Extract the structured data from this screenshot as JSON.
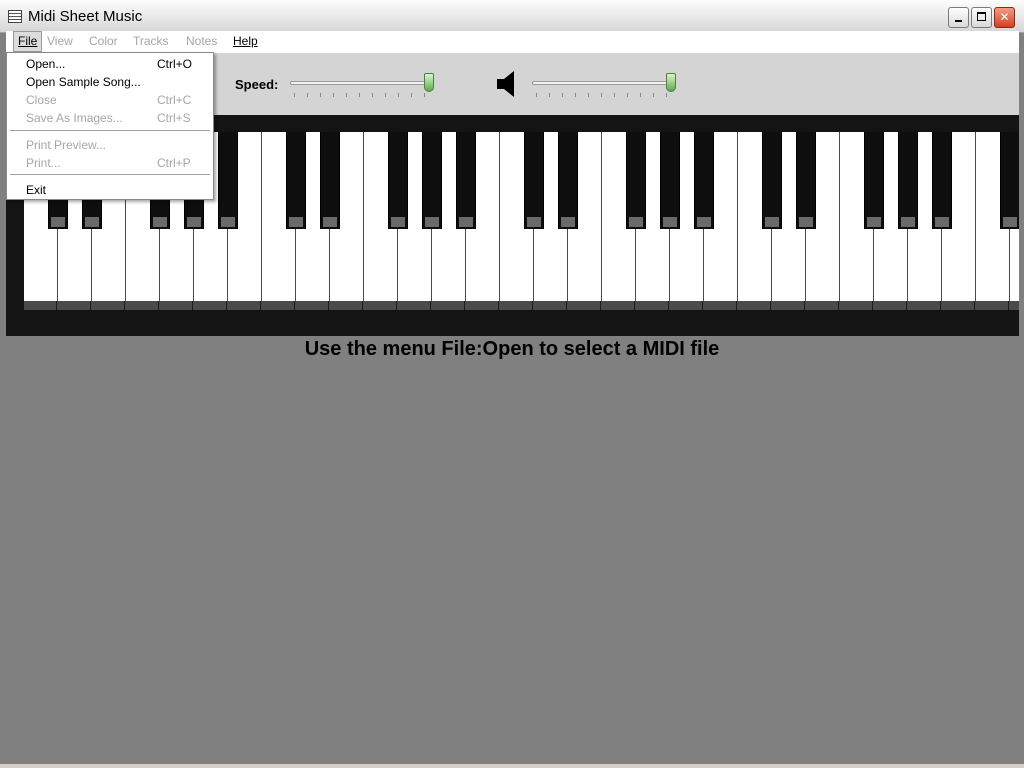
{
  "window": {
    "title": "Midi Sheet Music"
  },
  "menubar": {
    "file": "File",
    "view": "View",
    "color": "Color",
    "tracks": "Tracks",
    "notes": "Notes",
    "help": "Help"
  },
  "file_menu": {
    "open": {
      "label": "Open...",
      "shortcut": "Ctrl+O"
    },
    "open_sample": {
      "label": "Open Sample Song...",
      "shortcut": ""
    },
    "close": {
      "label": "Close",
      "shortcut": "Ctrl+C"
    },
    "save_images": {
      "label": "Save As Images...",
      "shortcut": "Ctrl+S"
    },
    "print_preview": {
      "label": "Print Preview...",
      "shortcut": ""
    },
    "print": {
      "label": "Print...",
      "shortcut": "Ctrl+P"
    },
    "exit": {
      "label": "Exit",
      "shortcut": ""
    }
  },
  "toolbar": {
    "speed_label": "Speed:",
    "speed_level": 1.0,
    "volume_level": 1.0
  },
  "status": {
    "message": "Use the menu File:Open to select a MIDI file"
  },
  "colors": {
    "background": "#808080",
    "toolbar": "#d4d4d4",
    "piano_frame": "#141414",
    "slider_thumb": "#5daa4a"
  },
  "icons": [
    "app-icon",
    "speaker-icon",
    "minimize-icon",
    "maximize-icon",
    "close-icon"
  ]
}
